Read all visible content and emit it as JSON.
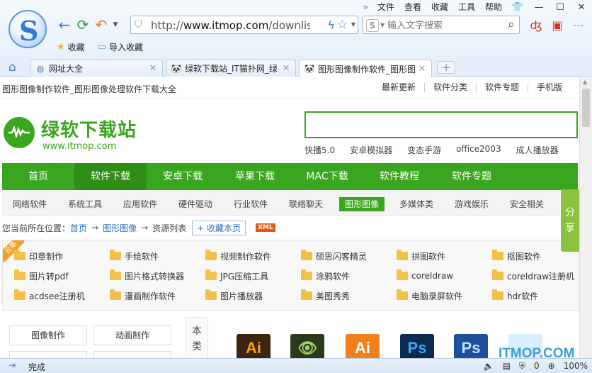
{
  "browser": {
    "menu": [
      "文件",
      "查看",
      "收藏",
      "工具",
      "帮助"
    ],
    "address": {
      "prefix": "http://",
      "host": "www.itmop.com",
      "path": "/downlist/r"
    },
    "search_placeholder": "输入文字搜索",
    "bookmarks": [
      "收藏",
      "导入收藏"
    ],
    "tabs": [
      {
        "label": "网址大全"
      },
      {
        "label": "绿软下载站_IT猫扑网_绿"
      },
      {
        "label": "图形图像制作软件_图形图"
      }
    ],
    "status": {
      "text": "完成",
      "count": "0",
      "zoom": "100%"
    }
  },
  "site": {
    "top_title": "图形图像制作软件_图形图像处理软件下载大全",
    "top_links": [
      "最新更新",
      "软件分类",
      "软件专题",
      "手机版"
    ],
    "name": "绿软下载站",
    "url": "www.itmop.com",
    "hot_words": [
      "快播5.0",
      "安卓模拟器",
      "变态手游",
      "office2003",
      "成人播放器"
    ],
    "main_nav": [
      "首页",
      "软件下载",
      "安卓下载",
      "苹果下载",
      "MAC下载",
      "软件教程",
      "软件专题"
    ],
    "sub_nav": [
      "网络软件",
      "系统工具",
      "应用软件",
      "硬件驱动",
      "行业软件",
      "联络聊天",
      "图形图像",
      "多媒体类",
      "游戏娱乐",
      "安全相关"
    ],
    "share": [
      "分",
      "享"
    ],
    "breadcrumb": {
      "prefix": "您当前所在位置：",
      "home": "首页",
      "cat": "图形图像",
      "current": "资源列表",
      "fav": "+ 收藏本页",
      "xml": "XML"
    },
    "ribbon": "合集",
    "categories": [
      [
        "印章制作",
        "手绘软件",
        "视频制作软件",
        "硕思闪客精灵",
        "拼图软件",
        "抠图软件"
      ],
      [
        "图片转pdf",
        "图片格式转换器",
        "JPG压缩工具",
        "涂鸦软件",
        "coreldraw",
        "coreldraw注册机"
      ],
      [
        "acdsee注册机",
        "漫画制作软件",
        "图片播放器",
        "美图秀秀",
        "电脑录屏软件",
        "hdr软件"
      ]
    ],
    "left_buttons": [
      "图像制作",
      "动画制作"
    ],
    "vertical_tab": [
      "本",
      "类"
    ],
    "app_icons": [
      "Ai",
      "",
      "Ai",
      "Ps",
      "Ps"
    ],
    "watermark": "ITMOP.COM"
  }
}
